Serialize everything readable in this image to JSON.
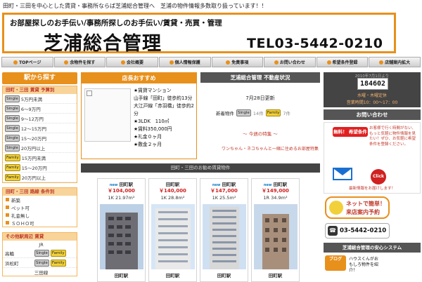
{
  "top_line": "田町・三田を中心とした賃貸・事務所ならば芝浦総合管理へ　芝浦の物件情報多数取り扱っています！！",
  "banner": {
    "slogan": "お部屋探しのお手伝い/事務所探しのお手伝い/賃貸・売買・管理",
    "company": "芝浦総合管理",
    "tel": "TEL03-5442-0210"
  },
  "nav": [
    "TOPページ",
    "余物件を探す",
    "会社概要",
    "個人情報保護",
    "免責事項",
    "お問い合わせ",
    "希望条件登録",
    "店舗案内拡大"
  ],
  "left": {
    "header": "駅から探す",
    "station_bar": "田町・三田 賃貸 予算別",
    "ranges": [
      {
        "tags": [
          "Single"
        ],
        "label": "5万円未満"
      },
      {
        "tags": [
          "Single"
        ],
        "label": "6～9万円"
      },
      {
        "tags": [
          "Single"
        ],
        "label": "9～12万円"
      },
      {
        "tags": [
          "Single"
        ],
        "label": "12～15万円"
      },
      {
        "tags": [
          "Single"
        ],
        "label": "15～20万円"
      },
      {
        "tags": [
          "Single"
        ],
        "label": "20万円以上"
      },
      {
        "tags": [
          "Family"
        ],
        "label": "15万円未満"
      },
      {
        "tags": [
          "Family"
        ],
        "label": "15～20万円"
      },
      {
        "tags": [
          "Family"
        ],
        "label": "20万円以上"
      }
    ],
    "condition_bar": "田町・三田 路線 条件別",
    "conditions": [
      "新築",
      "ペット可",
      "礼金無し",
      "ＳＯＨＯ可"
    ],
    "other_bar": "その他駅周辺 賃貸",
    "line": "JR",
    "stations": [
      {
        "name": "高輪",
        "tags": [
          "Single",
          "Family"
        ]
      },
      {
        "name": "浜松町",
        "tags": [
          "Single",
          "Family"
        ]
      },
      {
        "name": "三田線",
        "tags": []
      }
    ]
  },
  "recommend": {
    "header": "店長おすすめ",
    "lines": [
      "★賃貸マンション",
      "山手線「田町」徒歩約13分",
      "大江戸線「赤羽橋」徒歩約2分",
      "★3LDK　110㎡",
      "★賃料350,000円",
      "★礼金０ヶ月",
      "★敷金２ヶ月"
    ]
  },
  "news": {
    "header": "芝浦総合管理 不動産状況",
    "date": "7月28日更新",
    "new_label": "新着物件",
    "single_tag": "Single",
    "single_count": "14件",
    "family_tag": "Family",
    "family_count": "7件",
    "special": "～ 今週の特集 ～",
    "dog_text": "ワンちゃん・ネコちゃんと一緒に住めるお部屋特集"
  },
  "grid_header": "田町・三田のお勧め賃貸物件",
  "cards": [
    {
      "logo": "new",
      "station": "田町駅",
      "price": "￥104,000",
      "spec": "1K 21.97m²",
      "footer": "田町駅"
    },
    {
      "logo": "",
      "station": "田町駅",
      "price": "￥140,000",
      "spec": "1K 28.8m²",
      "footer": "田町駅"
    },
    {
      "logo": "new",
      "station": "田町駅",
      "price": "￥147,000",
      "spec": "1K 25.5m²",
      "footer": "田町駅"
    },
    {
      "logo": "new",
      "station": "田町駅",
      "price": "￥149,000",
      "spec": "1R 34.9m²",
      "footer": "田町駅"
    }
  ],
  "counter": {
    "since": "2010年7月1日より",
    "count": "184602",
    "closed": "水曜・木曜定休",
    "hours": "営業時間10：00～17：00"
  },
  "inquiry": "お問い合わせ",
  "wish": {
    "button": "無料！ 希望条件登録",
    "text": "お客様で行く時間がない、もっと気軽に物件情報を見たい！ぜひ、お気軽に希望条件を登録ください。",
    "click": "Click",
    "foot": "最新情報をお届けします！"
  },
  "netres": {
    "line1": "ネットで簡単！",
    "line2": "来店案内予約"
  },
  "tel_box": "03-5442-0210",
  "security": "芝浦総合管理の安心システム",
  "blog": {
    "label": "ブログ",
    "text": "ハウスくんがおもしろ物件を紹介！"
  },
  "colors": {
    "accent": "#e8901c",
    "price": "#d21f1f",
    "dark": "#444444"
  }
}
